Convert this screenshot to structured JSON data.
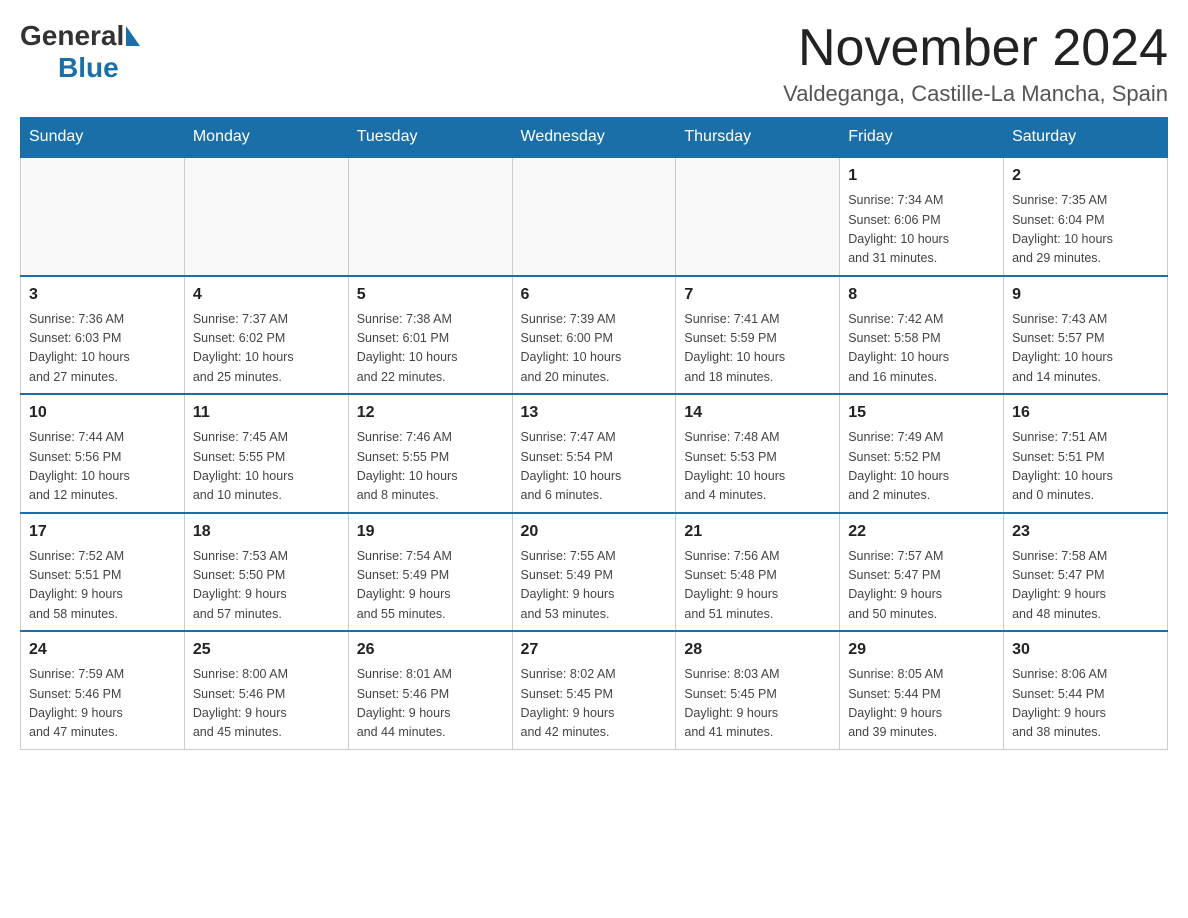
{
  "header": {
    "logo_general": "General",
    "logo_blue": "Blue",
    "month_title": "November 2024",
    "location": "Valdeganga, Castille-La Mancha, Spain"
  },
  "days_of_week": [
    "Sunday",
    "Monday",
    "Tuesday",
    "Wednesday",
    "Thursday",
    "Friday",
    "Saturday"
  ],
  "weeks": [
    {
      "days": [
        {
          "date": "",
          "info": ""
        },
        {
          "date": "",
          "info": ""
        },
        {
          "date": "",
          "info": ""
        },
        {
          "date": "",
          "info": ""
        },
        {
          "date": "",
          "info": ""
        },
        {
          "date": "1",
          "info": "Sunrise: 7:34 AM\nSunset: 6:06 PM\nDaylight: 10 hours\nand 31 minutes."
        },
        {
          "date": "2",
          "info": "Sunrise: 7:35 AM\nSunset: 6:04 PM\nDaylight: 10 hours\nand 29 minutes."
        }
      ]
    },
    {
      "days": [
        {
          "date": "3",
          "info": "Sunrise: 7:36 AM\nSunset: 6:03 PM\nDaylight: 10 hours\nand 27 minutes."
        },
        {
          "date": "4",
          "info": "Sunrise: 7:37 AM\nSunset: 6:02 PM\nDaylight: 10 hours\nand 25 minutes."
        },
        {
          "date": "5",
          "info": "Sunrise: 7:38 AM\nSunset: 6:01 PM\nDaylight: 10 hours\nand 22 minutes."
        },
        {
          "date": "6",
          "info": "Sunrise: 7:39 AM\nSunset: 6:00 PM\nDaylight: 10 hours\nand 20 minutes."
        },
        {
          "date": "7",
          "info": "Sunrise: 7:41 AM\nSunset: 5:59 PM\nDaylight: 10 hours\nand 18 minutes."
        },
        {
          "date": "8",
          "info": "Sunrise: 7:42 AM\nSunset: 5:58 PM\nDaylight: 10 hours\nand 16 minutes."
        },
        {
          "date": "9",
          "info": "Sunrise: 7:43 AM\nSunset: 5:57 PM\nDaylight: 10 hours\nand 14 minutes."
        }
      ]
    },
    {
      "days": [
        {
          "date": "10",
          "info": "Sunrise: 7:44 AM\nSunset: 5:56 PM\nDaylight: 10 hours\nand 12 minutes."
        },
        {
          "date": "11",
          "info": "Sunrise: 7:45 AM\nSunset: 5:55 PM\nDaylight: 10 hours\nand 10 minutes."
        },
        {
          "date": "12",
          "info": "Sunrise: 7:46 AM\nSunset: 5:55 PM\nDaylight: 10 hours\nand 8 minutes."
        },
        {
          "date": "13",
          "info": "Sunrise: 7:47 AM\nSunset: 5:54 PM\nDaylight: 10 hours\nand 6 minutes."
        },
        {
          "date": "14",
          "info": "Sunrise: 7:48 AM\nSunset: 5:53 PM\nDaylight: 10 hours\nand 4 minutes."
        },
        {
          "date": "15",
          "info": "Sunrise: 7:49 AM\nSunset: 5:52 PM\nDaylight: 10 hours\nand 2 minutes."
        },
        {
          "date": "16",
          "info": "Sunrise: 7:51 AM\nSunset: 5:51 PM\nDaylight: 10 hours\nand 0 minutes."
        }
      ]
    },
    {
      "days": [
        {
          "date": "17",
          "info": "Sunrise: 7:52 AM\nSunset: 5:51 PM\nDaylight: 9 hours\nand 58 minutes."
        },
        {
          "date": "18",
          "info": "Sunrise: 7:53 AM\nSunset: 5:50 PM\nDaylight: 9 hours\nand 57 minutes."
        },
        {
          "date": "19",
          "info": "Sunrise: 7:54 AM\nSunset: 5:49 PM\nDaylight: 9 hours\nand 55 minutes."
        },
        {
          "date": "20",
          "info": "Sunrise: 7:55 AM\nSunset: 5:49 PM\nDaylight: 9 hours\nand 53 minutes."
        },
        {
          "date": "21",
          "info": "Sunrise: 7:56 AM\nSunset: 5:48 PM\nDaylight: 9 hours\nand 51 minutes."
        },
        {
          "date": "22",
          "info": "Sunrise: 7:57 AM\nSunset: 5:47 PM\nDaylight: 9 hours\nand 50 minutes."
        },
        {
          "date": "23",
          "info": "Sunrise: 7:58 AM\nSunset: 5:47 PM\nDaylight: 9 hours\nand 48 minutes."
        }
      ]
    },
    {
      "days": [
        {
          "date": "24",
          "info": "Sunrise: 7:59 AM\nSunset: 5:46 PM\nDaylight: 9 hours\nand 47 minutes."
        },
        {
          "date": "25",
          "info": "Sunrise: 8:00 AM\nSunset: 5:46 PM\nDaylight: 9 hours\nand 45 minutes."
        },
        {
          "date": "26",
          "info": "Sunrise: 8:01 AM\nSunset: 5:46 PM\nDaylight: 9 hours\nand 44 minutes."
        },
        {
          "date": "27",
          "info": "Sunrise: 8:02 AM\nSunset: 5:45 PM\nDaylight: 9 hours\nand 42 minutes."
        },
        {
          "date": "28",
          "info": "Sunrise: 8:03 AM\nSunset: 5:45 PM\nDaylight: 9 hours\nand 41 minutes."
        },
        {
          "date": "29",
          "info": "Sunrise: 8:05 AM\nSunset: 5:44 PM\nDaylight: 9 hours\nand 39 minutes."
        },
        {
          "date": "30",
          "info": "Sunrise: 8:06 AM\nSunset: 5:44 PM\nDaylight: 9 hours\nand 38 minutes."
        }
      ]
    }
  ]
}
